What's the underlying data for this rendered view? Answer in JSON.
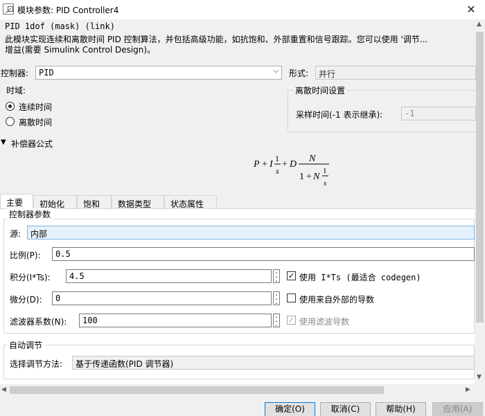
{
  "window": {
    "title": "模块参数: PID Controller4",
    "close_icon": "✕"
  },
  "block": {
    "name": "PID 1dof (mask) (link)",
    "description_line1": "此模块实现连续和离散时间 PID 控制算法，并包括高级功能，如抗饱和、外部重置和信号跟踪。您可以使用 '调节...",
    "description_line2": "增益(需要 Simulink Control Design)。"
  },
  "controller": {
    "label": "控制器:",
    "value": "PID"
  },
  "form": {
    "label": "形式:",
    "value": "并行"
  },
  "time_domain": {
    "title": "时域:",
    "continuous": "连续时间",
    "discrete": "离散时间",
    "selected": "continuous"
  },
  "discrete_settings": {
    "title": "离散时间设置",
    "sample_time_label": "采样时间(-1 表示继承):",
    "sample_time_value": "-1"
  },
  "compensator": {
    "title": "补偿器公式"
  },
  "tabs": [
    {
      "label": "主要",
      "active": true
    },
    {
      "label": "初始化"
    },
    {
      "label": "饱和"
    },
    {
      "label": "数据类型"
    },
    {
      "label": "状态属性"
    }
  ],
  "controller_params": {
    "title": "控制器参数",
    "source_label": "源:",
    "source_value": "内部",
    "p_label": "比例(P):",
    "p_value": "0.5",
    "i_label": "积分(I*Ts):",
    "i_value": "4.5",
    "d_label": "微分(D):",
    "d_value": "0",
    "n_label": "滤波器系数(N):",
    "n_value": "100",
    "use_its_label": "使用 I*Ts (最适合 codegen)",
    "use_its_checked": true,
    "use_ext_deriv_label": "使用来自外部的导数",
    "use_ext_deriv_checked": false,
    "use_filter_label": "使用滤波导数",
    "use_filter_checked": true
  },
  "autotune": {
    "title": "自动调节",
    "method_label": "选择调节方法:",
    "method_value": "基于传递函数(PID 调节器)"
  },
  "buttons": {
    "ok": "确定(O)",
    "cancel": "取消(C)",
    "help": "帮助(H)",
    "apply": "应用(A)"
  }
}
